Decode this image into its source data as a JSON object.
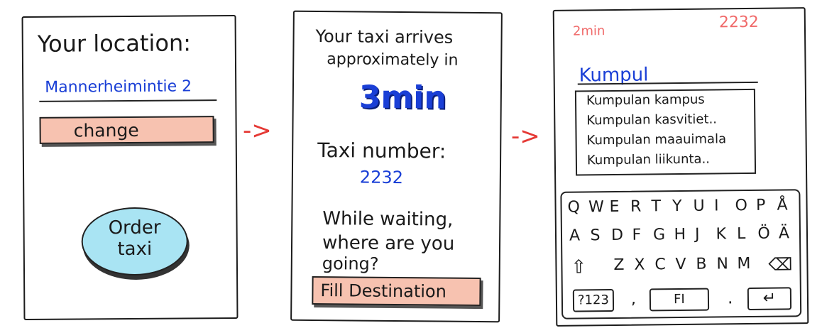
{
  "screen1": {
    "location_label": "Your location:",
    "location_value": "Mannerheimintie 2",
    "change_button": "change",
    "order_button_line1": "Order",
    "order_button_line2": "taxi"
  },
  "screen2": {
    "arrives_line1": "Your taxi arrives",
    "arrives_line2": "approximately in",
    "eta": "3min",
    "taxi_number_label": "Taxi number:",
    "taxi_number": "2232",
    "question_line1": "While waiting,",
    "question_line2": "where are you",
    "question_line3": "going?",
    "fill_button": "Fill Destination"
  },
  "screen3": {
    "eta": "2min",
    "taxi_number": "2232",
    "search_value": "Kumpul",
    "suggestions": [
      "Kumpulan kampus",
      "Kumpulan kasvitiet..",
      "Kumpulan maauimala",
      "Kumpulan liikunta.."
    ],
    "keyboard": {
      "row1": [
        "Q",
        "W",
        "E",
        "R",
        "T",
        "Y",
        "U",
        "I",
        "O",
        "P",
        "Å"
      ],
      "row2": [
        "A",
        "S",
        "D",
        "F",
        "G",
        "H",
        "J",
        "K",
        "L",
        "Ö",
        "Ä"
      ],
      "row3": [
        "Z",
        "X",
        "C",
        "V",
        "B",
        "N",
        "M"
      ],
      "num_key": "?123",
      "comma_key": ",",
      "lang_key": "FI",
      "period_key": "."
    }
  },
  "arrows": [
    "->",
    "->"
  ],
  "colors": {
    "ink": "#1c1c1c",
    "blue_text": "#1a3fd6",
    "accent_red": "#e53935",
    "peach": "#f7c2b0",
    "cyan": "#a9e4f3",
    "pink_text": "#f06a6a"
  }
}
